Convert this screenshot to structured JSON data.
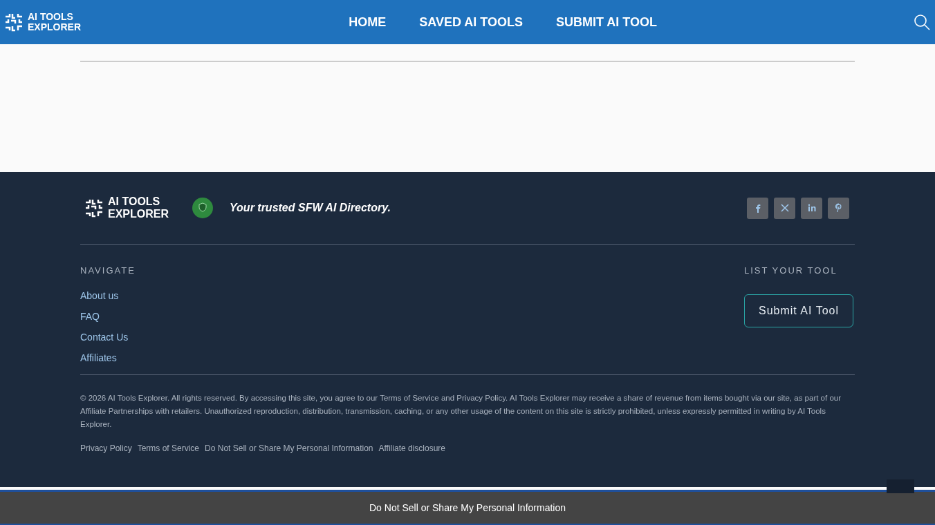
{
  "header": {
    "logo_text": "AI TOOLS EXPLORER",
    "nav": [
      {
        "label": "HOME"
      },
      {
        "label": "SAVED AI TOOLS"
      },
      {
        "label": "SUBMIT AI TOOL"
      }
    ]
  },
  "footer": {
    "logo_text": "AI TOOLS EXPLORER",
    "tagline": "Your trusted SFW AI Directory.",
    "social": [
      {
        "kind": "facebook"
      },
      {
        "kind": "x"
      },
      {
        "kind": "linkedin"
      },
      {
        "kind": "pinterest"
      }
    ],
    "navigate": {
      "heading": "NAVIGATE",
      "links": [
        "About us",
        "FAQ",
        "Contact Us",
        "Affiliates"
      ]
    },
    "list_tool": {
      "heading": "LIST YOUR TOOL",
      "button": "Submit AI Tool"
    },
    "copyright": "© 2026 AI Tools Explorer. All rights reserved. By accessing this site, you agree to our Terms of Service and Privacy Policy. AI Tools Explorer may receive a share of revenue from items bought via our site, as part of our Affiliate Partnerships with retailers. Unauthorized reproduction, distribution, transmission, caching, or any other usage of the content on this site is strictly prohibited, unless expressly permitted in writing by AI Tools Explorer.",
    "legal_links": [
      "Privacy Policy",
      "Terms of Service",
      "Do Not Sell or Share My Personal Information",
      "Affiliate disclosure"
    ]
  },
  "consent_bar": {
    "text": "Do Not Sell or Share My Personal Information"
  }
}
